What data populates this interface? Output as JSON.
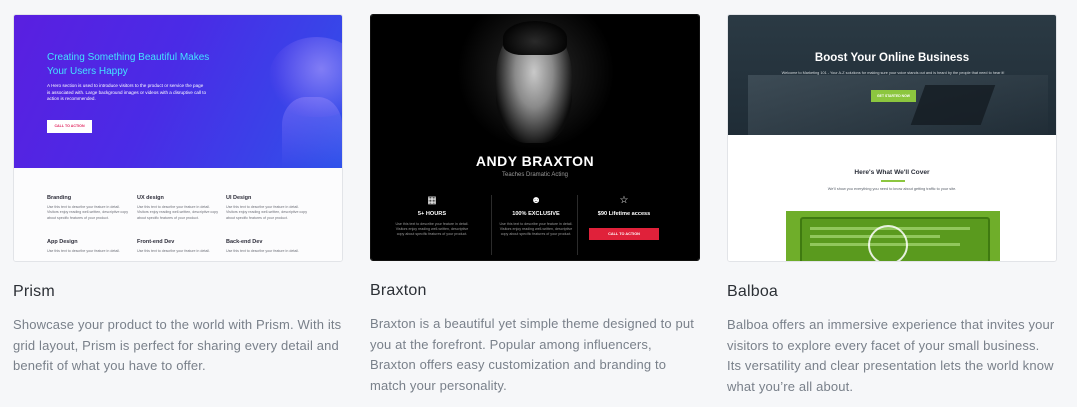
{
  "cards": [
    {
      "title": "Prism",
      "description": "Showcase your product to the world with Prism. With its grid layout, Prism is perfect for sharing every detail and benefit of what you have to offer.",
      "preview": {
        "headline": "Creating Something Beautiful Makes Your Users Happy",
        "subtext": "A Hero section is used to introduce visitors to the product or service the page is associated with. Large background images or videos with a disruptive call to action is recommended.",
        "cta": "CALL TO ACTION",
        "features": [
          {
            "title": "Branding",
            "text": "Use this text to describe your feature in detail. Visitors enjoy reading well-written, descriptive copy about specific features of your product."
          },
          {
            "title": "UX design",
            "text": "Use this text to describe your feature in detail. Visitors enjoy reading well-written, descriptive copy about specific features of your product."
          },
          {
            "title": "UI Design",
            "text": "Use this text to describe your feature in detail. Visitors enjoy reading well-written, descriptive copy about specific features of your product."
          },
          {
            "title": "App Design",
            "text": "Use this text to describe your feature in detail."
          },
          {
            "title": "Front-end Dev",
            "text": "Use this text to describe your feature in detail."
          },
          {
            "title": "Back-end Dev",
            "text": "Use this text to describe your feature in detail."
          }
        ]
      }
    },
    {
      "title": "Braxton",
      "description": "Braxton is a beautiful yet simple theme designed to put you at the forefront. Popular among influencers, Braxton offers easy customization and branding to match your personality.",
      "preview": {
        "name": "ANDY BRAXTON",
        "tagline": "Teaches Dramatic Acting",
        "columns": [
          {
            "icon": "clapperboard-icon",
            "glyph": "▦",
            "title": "5+ HOURS",
            "text": "Use this text to describe your feature in detail. Visitors enjoy reading well-written, descriptive copy about specific features of your product."
          },
          {
            "icon": "theater-masks-icon",
            "glyph": "☻",
            "title": "100% EXCLUSIVE",
            "text": "Use this text to describe your feature in detail. Visitors enjoy reading well-written, descriptive copy about specific features of your product."
          },
          {
            "icon": "star-icon",
            "glyph": "☆",
            "title": "$90 Lifetime access",
            "text": ""
          }
        ],
        "cta": "CALL TO ACTION"
      }
    },
    {
      "title": "Balboa",
      "description": "Balboa offers an immersive experience that invites your visitors to explore every facet of your small business. Its versatility and clear presentation lets the world know what you’re all about.",
      "preview": {
        "headline": "Boost Your Online Business",
        "subtext": "Welcome to Marketing 101 - Your A-Z solutions for making sure your voice stands out and is heard by the people that need to hear it!",
        "cta": "GET STARTED NOW",
        "section_title": "Here's What We'll Cover",
        "section_sub": "We'll show you everything you need to know about getting traffic to your site."
      }
    }
  ],
  "colors": {
    "prism_accent": "#44e3ff",
    "braxton_cta": "#e0213a",
    "balboa_accent": "#8cc63f"
  }
}
